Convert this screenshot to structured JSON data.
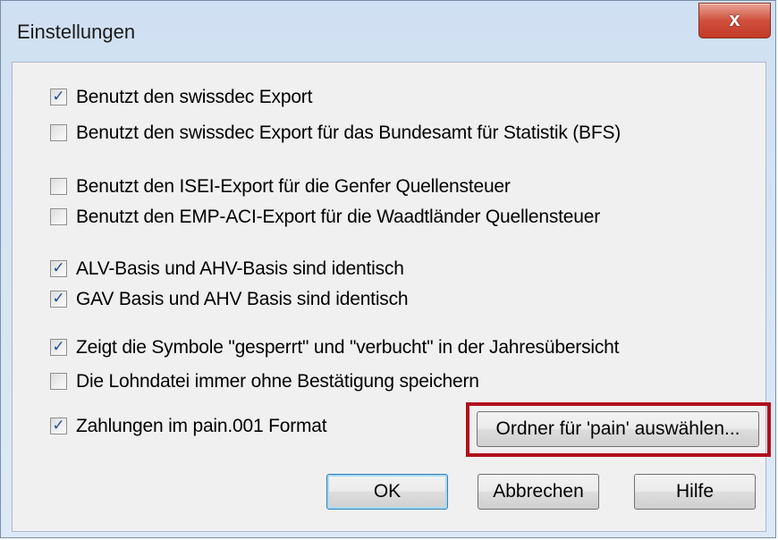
{
  "window": {
    "title": "Einstellungen",
    "close_label": "x"
  },
  "options": [
    {
      "label": "Benutzt den swissdec Export",
      "checked": true
    },
    {
      "label": "Benutzt den swissdec Export für das Bundesamt für Statistik (BFS)",
      "checked": false
    },
    {
      "label": "Benutzt den ISEI-Export für die Genfer Quellensteuer",
      "checked": false
    },
    {
      "label": "Benutzt den EMP-ACI-Export für die Waadtländer Quellensteuer",
      "checked": false
    },
    {
      "label": "ALV-Basis und AHV-Basis sind identisch",
      "checked": true
    },
    {
      "label": "GAV Basis und AHV Basis sind identisch",
      "checked": true
    },
    {
      "label": "Zeigt die Symbole \"gesperrt\" und \"verbucht\" in der Jahresübersicht",
      "checked": true
    },
    {
      "label": "Die Lohndatei immer ohne Bestätigung speichern",
      "checked": false
    },
    {
      "label": "Zahlungen im pain.001 Format",
      "checked": true
    }
  ],
  "buttons": {
    "select_folder": "Ordner für 'pain' auswählen...",
    "ok": "OK",
    "cancel": "Abbrechen",
    "help": "Hilfe"
  },
  "check_glyph": "✓"
}
